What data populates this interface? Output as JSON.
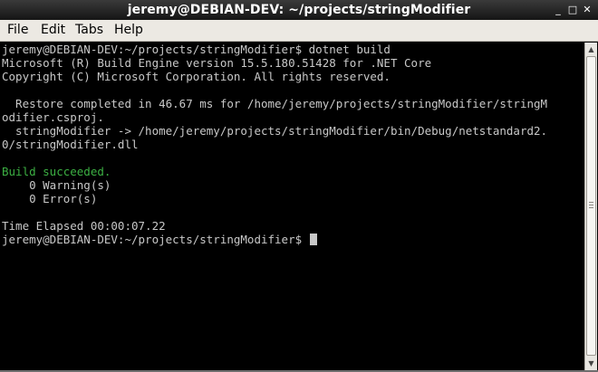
{
  "window": {
    "title": "jeremy@DEBIAN-DEV: ~/projects/stringModifier",
    "controls": {
      "minimize": "_",
      "maximize": "□",
      "close": "✕"
    }
  },
  "menu": {
    "file": "File",
    "edit": "Edit",
    "tabs": "Tabs",
    "help": "Help"
  },
  "terminal": {
    "lines": [
      "jeremy@DEBIAN-DEV:~/projects/stringModifier$ dotnet build",
      "Microsoft (R) Build Engine version 15.5.180.51428 for .NET Core",
      "Copyright (C) Microsoft Corporation. All rights reserved.",
      "",
      "  Restore completed in 46.67 ms for /home/jeremy/projects/stringModifier/stringM",
      "odifier.csproj.",
      "  stringModifier -> /home/jeremy/projects/stringModifier/bin/Debug/netstandard2.",
      "0/stringModifier.dll",
      "",
      "Build succeeded.",
      "    0 Warning(s)",
      "    0 Error(s)",
      "",
      "Time Elapsed 00:00:07.22",
      "jeremy@DEBIAN-DEV:~/projects/stringModifier$ "
    ]
  },
  "colors": {
    "success_text": "#3cb043",
    "terminal_bg": "#000000",
    "terminal_fg": "#c8c8c8"
  }
}
